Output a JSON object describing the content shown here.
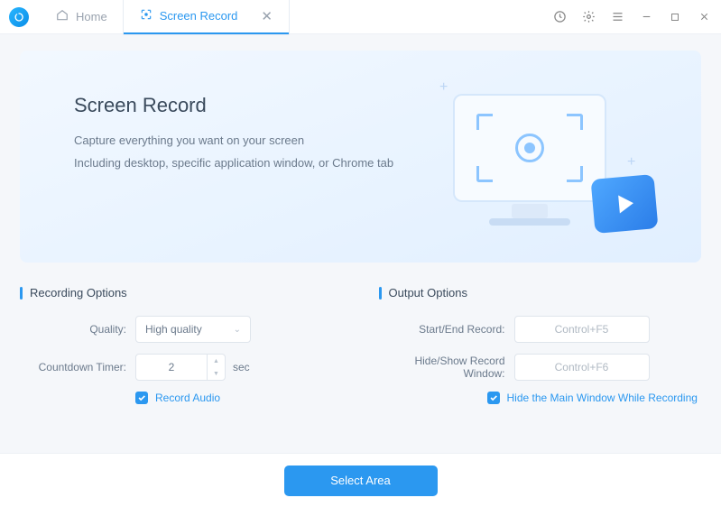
{
  "tabs": {
    "home": "Home",
    "screen_record": "Screen Record"
  },
  "hero": {
    "title": "Screen Record",
    "line1": "Capture everything you want on your screen",
    "line2": "Including desktop, specific application window, or Chrome tab"
  },
  "recording_options": {
    "section_title": "Recording Options",
    "quality_label": "Quality:",
    "quality_value": "High quality",
    "countdown_label": "Countdown Timer:",
    "countdown_value": "2",
    "sec_label": "sec",
    "record_audio_label": "Record Audio"
  },
  "output_options": {
    "section_title": "Output Options",
    "start_end_label": "Start/End Record:",
    "start_end_value": "Control+F5",
    "hide_show_label": "Hide/Show Record Window:",
    "hide_show_value": "Control+F6",
    "hide_main_label": "Hide the Main Window While Recording"
  },
  "footer": {
    "select_area": "Select Area"
  }
}
